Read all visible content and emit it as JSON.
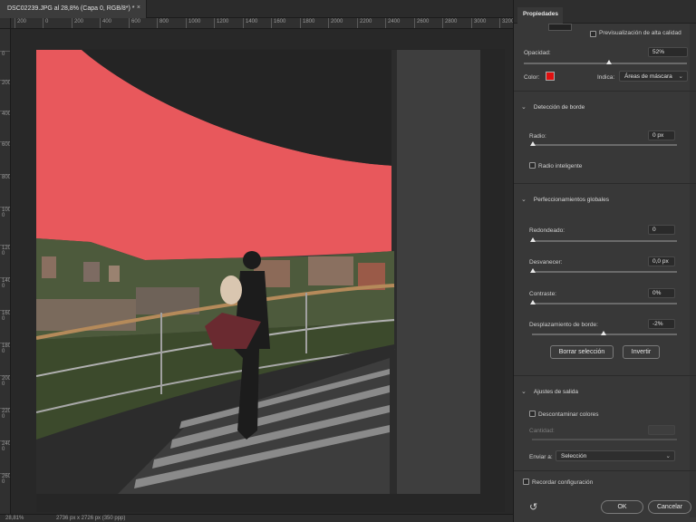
{
  "document": {
    "tab_title": "DSC02239.JPG al 28,8% (Capa 0, RGB/8*) *",
    "close_glyph": "×",
    "ruler_top_labels": [
      "200",
      "0",
      "200",
      "400",
      "600",
      "800",
      "1000",
      "1200",
      "1400",
      "1600",
      "1800",
      "2000",
      "2200",
      "2400",
      "2600",
      "2800",
      "3000",
      "3200"
    ],
    "ruler_left_labels": [
      "0",
      "200",
      "400",
      "600",
      "800",
      "1000",
      "1200",
      "1400",
      "1600",
      "1800",
      "2000",
      "2200",
      "2400",
      "2600"
    ],
    "status_zoom": "28,81%",
    "status_size": "2736 px x 2726 px (350 ppp)"
  },
  "panel": {
    "tab": "Propiedades",
    "hq_preview_label": "Previsualización de alta calidad",
    "opacity_label": "Opacidad:",
    "opacity_value": "52%",
    "opacity_level": 0.52,
    "color_label": "Color:",
    "color_value": "#e01010",
    "indicates_label": "Indica:",
    "indicates_value": "Áreas de máscara",
    "edge_section": "Detección de borde",
    "radius_label": "Radio:",
    "radius_value": "0 px",
    "smart_radius_label": "Radio inteligente",
    "global_section": "Perfeccionamientos globales",
    "smooth_label": "Redondeado:",
    "smooth_value": "0",
    "feather_label": "Desvanecer:",
    "feather_value": "0,0 px",
    "contrast_label": "Contraste:",
    "contrast_value": "0%",
    "shift_label": "Desplazamiento de borde:",
    "shift_value": "-2%",
    "clear_btn": "Borrar selección",
    "invert_btn": "Invertir",
    "output_section": "Ajustes de salida",
    "decontaminate_label": "Descontaminar colores",
    "amount_label": "Cantidad:",
    "output_to_label": "Enviar a:",
    "output_to_value": "Selección",
    "remember_label": "Recordar configuración",
    "ok_btn": "OK",
    "cancel_btn": "Cancelar",
    "chevron_glyph": "⌄",
    "dropdown_glyph": "⌄",
    "reset_glyph": "↺"
  },
  "colors": {
    "mask_overlay": "#e8585c",
    "accent": "#e01010"
  }
}
